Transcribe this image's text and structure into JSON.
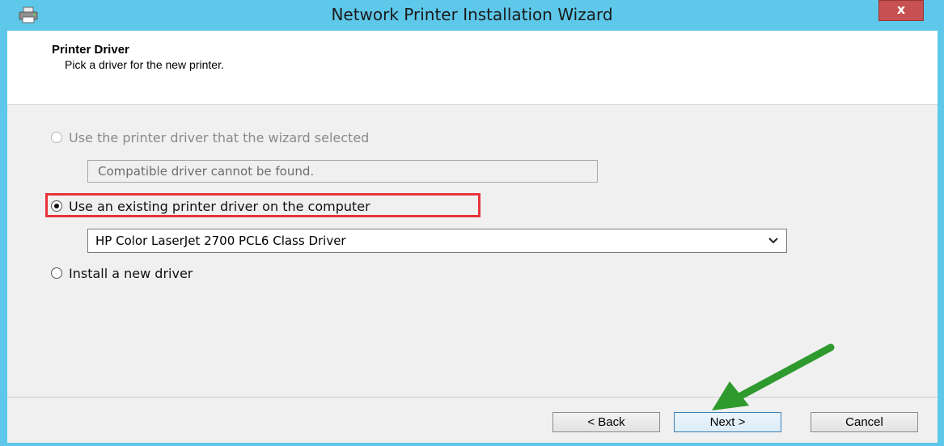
{
  "window": {
    "title": "Network Printer Installation Wizard",
    "close_label": "x"
  },
  "header": {
    "title": "Printer Driver",
    "subtitle": "Pick a driver for the new printer."
  },
  "options": {
    "wizard_selected": {
      "label": "Use the printer driver that the wizard selected",
      "selected": false,
      "enabled": false,
      "detail": "Compatible driver cannot be found."
    },
    "existing_driver": {
      "label": "Use an existing printer driver on the computer",
      "selected": true,
      "enabled": true,
      "selected_value": "HP Color LaserJet 2700 PCL6 Class Driver"
    },
    "install_new": {
      "label": "Install a new driver",
      "selected": false,
      "enabled": true
    }
  },
  "buttons": {
    "back": "< Back",
    "next": "Next >",
    "cancel": "Cancel"
  },
  "colors": {
    "title_bar": "#5ec8ea",
    "highlight_box": "#e8333a",
    "annotation_arrow": "#2e9a2e"
  },
  "icons": {
    "app": "printer-icon",
    "close": "close-icon",
    "dropdown": "chevron-down-icon",
    "annotation": "green-arrow-annotation"
  }
}
